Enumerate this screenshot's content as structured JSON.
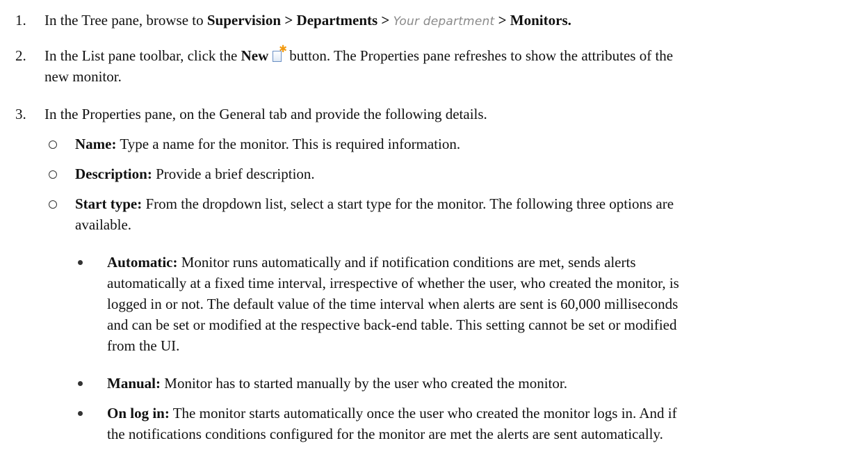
{
  "steps": [
    {
      "num": "1.",
      "pre": "In the Tree pane, browse to ",
      "path_bold_1": "Supervision > Departments > ",
      "path_italic": "Your department",
      "path_bold_2": " > Monitors."
    },
    {
      "num": "2.",
      "pre": "In the List pane toolbar, click the ",
      "bold": "New",
      "icon": "new-document-icon",
      "post_line1": "button. The Properties pane refreshes to show the attributes of the",
      "post_line2": "new monitor."
    },
    {
      "num": "3.",
      "text": "In the Properties pane, on the General tab and provide the following details."
    }
  ],
  "fields": [
    {
      "label": "Name:",
      "text": " Type a name for the monitor. This is required information."
    },
    {
      "label": "Description:",
      "text": " Provide a brief description."
    },
    {
      "label": "Start type:",
      "text_line1": " From the dropdown list, select a start type for the monitor. The following three options are",
      "text_line2": "available."
    }
  ],
  "start_types": [
    {
      "label": "Automatic:",
      "lines": [
        " Monitor runs automatically and if notification conditions are met, sends alerts",
        "automatically at a fixed time interval, irrespective of whether the user, who created the monitor, is",
        "logged in or not. The default value of the time interval when alerts are sent is 60,000 milliseconds",
        "and can be set or modified at the respective back-end table. This setting cannot be set or modified",
        "from the UI."
      ]
    },
    {
      "label": "Manual:",
      "lines": [
        " Monitor has to started manually by the user who created the monitor."
      ]
    },
    {
      "label": "On log in:",
      "lines": [
        " The monitor starts automatically once the user who created the monitor logs in. And if",
        "the notifications conditions configured for the monitor are met the alerts are sent automatically."
      ]
    }
  ]
}
